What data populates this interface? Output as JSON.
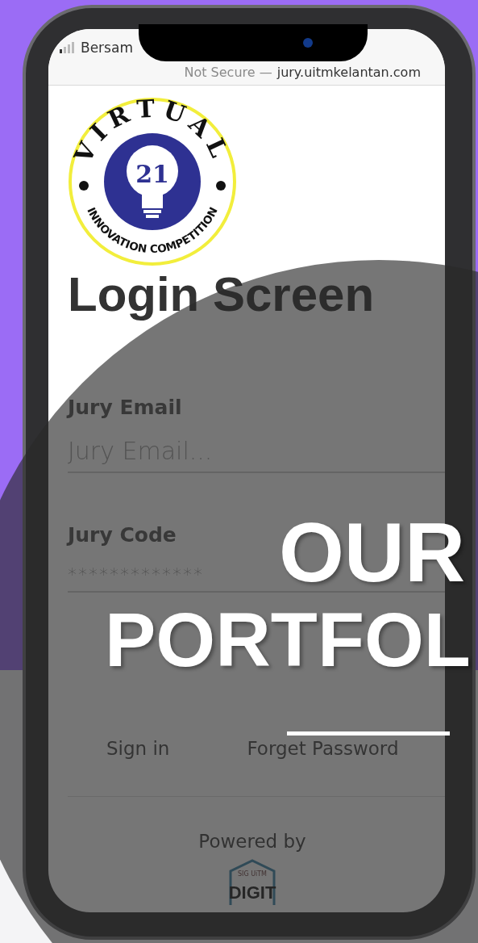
{
  "status_bar": {
    "carrier": "Bersam"
  },
  "address_bar": {
    "security": "Not Secure —",
    "url": "jury.uitmkelantan.com"
  },
  "logo": {
    "top_text": "VIRTUAL",
    "number": "21",
    "bottom_text": "INNOVATION COMPETITION"
  },
  "title": "Login Screen",
  "fields": [
    {
      "label": "Jury Email",
      "placeholder": "Jury Email..."
    },
    {
      "label": "Jury Code",
      "value": "*************"
    }
  ],
  "actions": [
    "Sign in",
    "Forget Password"
  ],
  "footer": {
    "text": "Powered by",
    "logo_subtitle": "SIG UiTM",
    "logo_text": "DIGIT"
  },
  "overlay": {
    "lines": [
      "OUR",
      "PORTFOL"
    ]
  }
}
